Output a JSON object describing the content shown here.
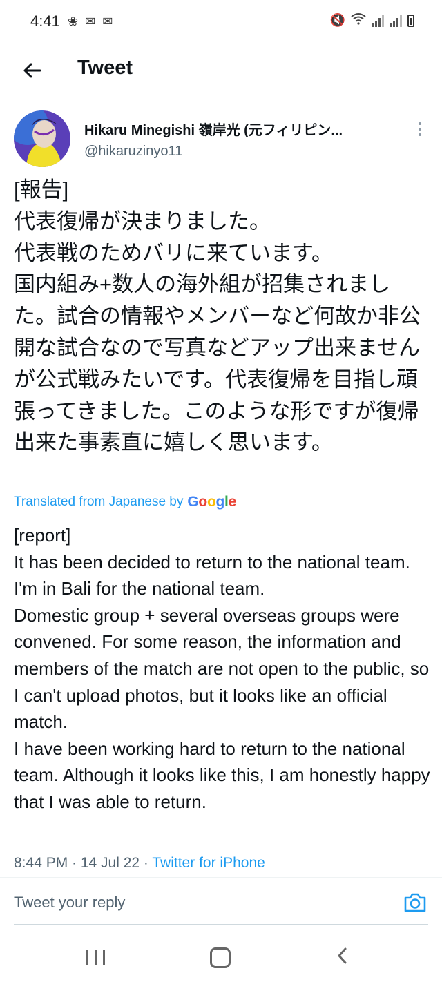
{
  "status_bar": {
    "time": "4:41"
  },
  "header": {
    "title": "Tweet"
  },
  "tweet": {
    "author_name": "Hikaru Minegishi 嶺岸光 (元フィリピン...",
    "author_handle": "@hikaruzinyo11",
    "text": "[報告]\n代表復帰が決まりました。\n代表戦のためバリに来ています。\n国内組み+数人の海外組が招集されました。試合の情報やメンバーなど何故か非公開な試合なので写真などアップ出来ませんが公式戦みたいです。代表復帰を目指し頑張ってきました。このような形ですが復帰出来た事素直に嬉しく思います。",
    "translated_label": "Translated from Japanese by",
    "google_letters": [
      "G",
      "o",
      "o",
      "g",
      "l",
      "e"
    ],
    "translated_text": "[report]\n It has been decided to return to the national team.\n I'm in Bali for the national team.\n Domestic group + several overseas groups were convened. For some reason, the information and members of the match are not open to the public, so I can't upload photos, but it looks like an official match.\nI have been working hard to return to the national team. Although it looks like this, I am honestly happy that I was able to return.",
    "timestamp": "8:44 PM · 14 Jul 22 · ",
    "source": "Twitter for iPhone"
  },
  "reply": {
    "placeholder": "Tweet your reply"
  },
  "colors": {
    "accent": "#1d9bf0",
    "text": "#0f1419",
    "secondary": "#536471"
  }
}
